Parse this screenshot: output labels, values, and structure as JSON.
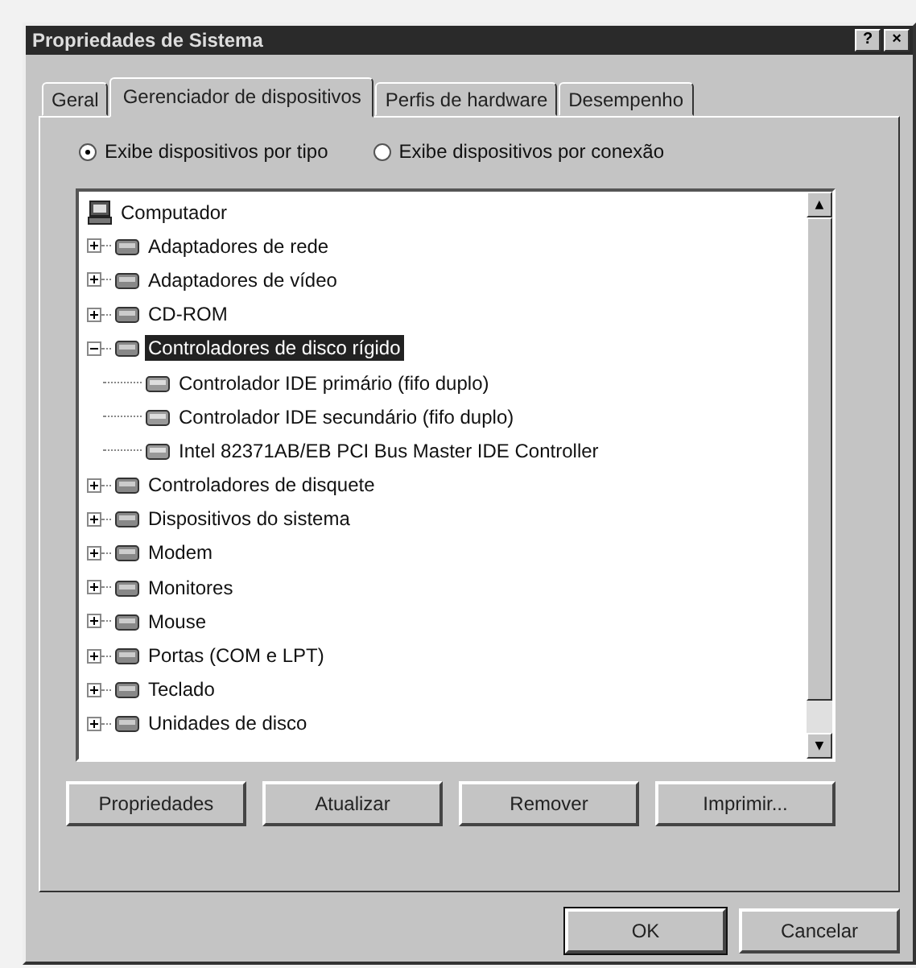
{
  "window": {
    "title": "Propriedades de Sistema",
    "title_buttons": [
      "?",
      "×"
    ]
  },
  "tabs": [
    {
      "label": "Geral",
      "selected": false
    },
    {
      "label": "Gerenciador de dispositivos",
      "selected": true
    },
    {
      "label": "Perfis de hardware",
      "selected": false
    },
    {
      "label": "Desempenho",
      "selected": false
    }
  ],
  "view_options": [
    {
      "label": "Exibe dispositivos por tipo",
      "selected": true
    },
    {
      "label": "Exibe dispositivos por conexão",
      "selected": false
    }
  ],
  "tree": {
    "label": "Computador",
    "children": [
      {
        "label": "Adaptadores de rede",
        "expanded": false,
        "selected": false
      },
      {
        "label": "Adaptadores de vídeo",
        "expanded": false,
        "selected": false
      },
      {
        "label": "CD-ROM",
        "expanded": false,
        "selected": false
      },
      {
        "label": "Controladores de disco rígido",
        "expanded": true,
        "selected": true,
        "children": [
          {
            "label": "Controlador IDE primário (fifo duplo)",
            "selected": false
          },
          {
            "label": "Controlador IDE secundário (fifo duplo)",
            "selected": false
          },
          {
            "label": "Intel 82371AB/EB PCI Bus Master IDE Controller",
            "selected": false
          }
        ]
      },
      {
        "label": "Controladores de disquete",
        "expanded": false,
        "selected": false
      },
      {
        "label": "Dispositivos do sistema",
        "expanded": false,
        "selected": false
      },
      {
        "label": "Modem",
        "expanded": false,
        "selected": false
      },
      {
        "label": "Monitores",
        "expanded": false,
        "selected": false
      },
      {
        "label": "Mouse",
        "expanded": false,
        "selected": false
      },
      {
        "label": "Portas (COM e LPT)",
        "expanded": false,
        "selected": false
      },
      {
        "label": "Teclado",
        "expanded": false,
        "selected": false
      },
      {
        "label": "Unidades de disco",
        "expanded": false,
        "selected": false
      }
    ]
  },
  "scrollbar_arrows": [
    "▲",
    "▼"
  ],
  "actions": [
    "Propriedades",
    "Atualizar",
    "Remover",
    "Imprimir..."
  ],
  "buttons": [
    "OK",
    "Cancelar"
  ]
}
